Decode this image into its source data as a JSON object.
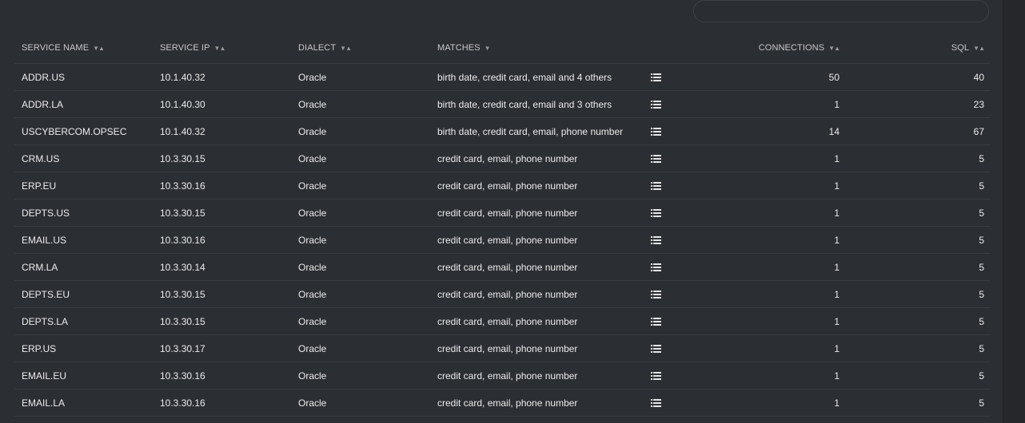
{
  "search": {
    "value": "",
    "placeholder": ""
  },
  "table": {
    "columns": {
      "service_name": "SERVICE NAME",
      "service_ip": "SERVICE IP",
      "dialect": "DIALECT",
      "matches": "MATCHES",
      "connections": "CONNECTIONS",
      "sql": "SQL"
    },
    "sort_glyph": "▼▲",
    "sort_glyph_matches": "▼",
    "rows": [
      {
        "service_name": "ADDR.US",
        "service_ip": "10.1.40.32",
        "dialect": "Oracle",
        "matches": "birth date, credit card, email and 4 others",
        "connections": "50",
        "sql": "40"
      },
      {
        "service_name": "ADDR.LA",
        "service_ip": "10.1.40.30",
        "dialect": "Oracle",
        "matches": "birth date, credit card, email and 3 others",
        "connections": "1",
        "sql": "23"
      },
      {
        "service_name": "USCYBERCOM.OPSEC",
        "service_ip": "10.1.40.32",
        "dialect": "Oracle",
        "matches": "birth date, credit card, email, phone number",
        "connections": "14",
        "sql": "67"
      },
      {
        "service_name": "CRM.US",
        "service_ip": "10.3.30.15",
        "dialect": "Oracle",
        "matches": "credit card, email, phone number",
        "connections": "1",
        "sql": "5"
      },
      {
        "service_name": "ERP.EU",
        "service_ip": "10.3.30.16",
        "dialect": "Oracle",
        "matches": "credit card, email, phone number",
        "connections": "1",
        "sql": "5"
      },
      {
        "service_name": "DEPTS.US",
        "service_ip": "10.3.30.15",
        "dialect": "Oracle",
        "matches": "credit card, email, phone number",
        "connections": "1",
        "sql": "5"
      },
      {
        "service_name": "EMAIL.US",
        "service_ip": "10.3.30.16",
        "dialect": "Oracle",
        "matches": "credit card, email, phone number",
        "connections": "1",
        "sql": "5"
      },
      {
        "service_name": "CRM.LA",
        "service_ip": "10.3.30.14",
        "dialect": "Oracle",
        "matches": "credit card, email, phone number",
        "connections": "1",
        "sql": "5"
      },
      {
        "service_name": "DEPTS.EU",
        "service_ip": "10.3.30.15",
        "dialect": "Oracle",
        "matches": "credit card, email, phone number",
        "connections": "1",
        "sql": "5"
      },
      {
        "service_name": "DEPTS.LA",
        "service_ip": "10.3.30.15",
        "dialect": "Oracle",
        "matches": "credit card, email, phone number",
        "connections": "1",
        "sql": "5"
      },
      {
        "service_name": "ERP.US",
        "service_ip": "10.3.30.17",
        "dialect": "Oracle",
        "matches": "credit card, email, phone number",
        "connections": "1",
        "sql": "5"
      },
      {
        "service_name": "EMAIL.EU",
        "service_ip": "10.3.30.16",
        "dialect": "Oracle",
        "matches": "credit card, email, phone number",
        "connections": "1",
        "sql": "5"
      },
      {
        "service_name": "EMAIL.LA",
        "service_ip": "10.3.30.16",
        "dialect": "Oracle",
        "matches": "credit card, email, phone number",
        "connections": "1",
        "sql": "5"
      }
    ]
  },
  "icons": {
    "sort": "sort-icon",
    "matches_detail": "list-icon"
  },
  "colors": {
    "background": "#25272b",
    "panel": "#2b2e33",
    "text": "#ececec",
    "header_text": "#c8c8c8",
    "divider": "#383b40"
  }
}
